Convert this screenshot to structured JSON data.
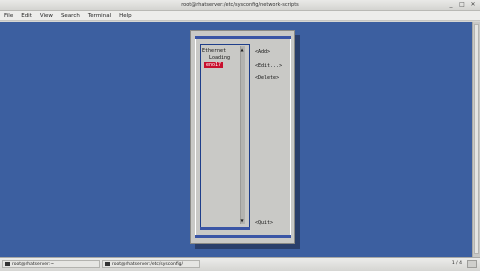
{
  "window": {
    "title": "root@rhatserver:/etc/sysconfig/network-scripts",
    "controls": {
      "minimize": "_",
      "maximize": "□",
      "close": "✕"
    }
  },
  "menu": [
    "File",
    "Edit",
    "View",
    "Search",
    "Terminal",
    "Help"
  ],
  "dialog": {
    "list_items": [
      "Ethernet",
      "Loading",
      "eno17"
    ],
    "selected_index": 2,
    "buttons": {
      "add": "<Add>",
      "edit": "<Edit...>",
      "delete": "<Delete>",
      "quit": "<Quit>"
    }
  },
  "taskbar": {
    "tasks": [
      "root@rhatserver:~",
      "root@rhatserver:/etc/sysconfig/"
    ],
    "pager": "1 / 4"
  },
  "colors": {
    "terminal_bg": "#3c5fa0",
    "dialog_bg": "#c9c9c6",
    "selection": "#c8102e"
  }
}
